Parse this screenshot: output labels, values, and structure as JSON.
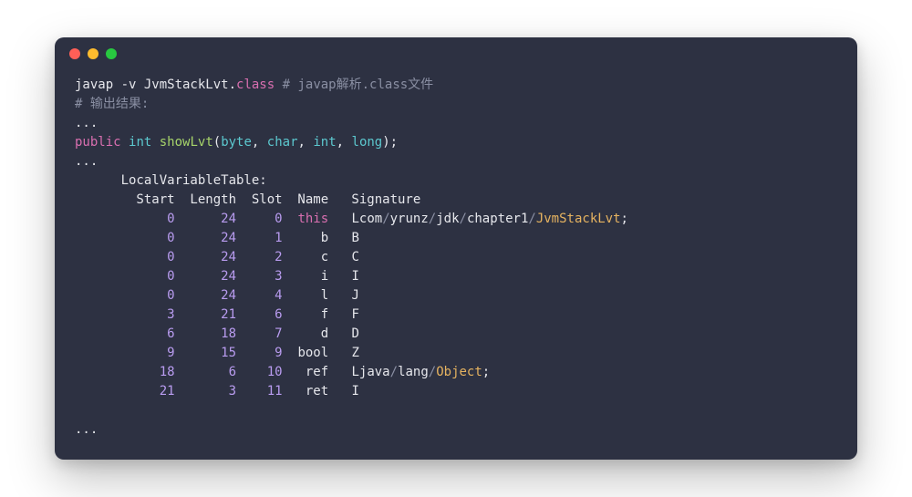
{
  "window": {
    "dot_red": "close",
    "dot_yellow": "minimize",
    "dot_green": "zoom"
  },
  "cmd": {
    "javap": "javap -v JvmStackLvt",
    "dot": ".",
    "class": "class",
    "comment_hash": " # javap解析.class文件"
  },
  "out_comment": "# 输出结果:",
  "ellipsis": "...",
  "sig": {
    "public": "public",
    "int": "int",
    "func": "showLvt",
    "lp": "(",
    "byte": "byte",
    "comma": ", ",
    "char": "char",
    "int2": "int",
    "long": "long",
    "rp": ");"
  },
  "lvt_header": "LocalVariableTable:",
  "columns": {
    "start": "Start",
    "length": "Length",
    "slot": "Slot",
    "name": "Name",
    "signature": "Signature"
  },
  "rows": [
    {
      "start": "0",
      "length": "24",
      "slot": "0",
      "name": "this",
      "sig_pre": "Lcom",
      "sig_segs": [
        "yrunz",
        "jdk",
        "chapter1"
      ],
      "sig_class": "JvmStackLvt",
      "sig_post": ";"
    },
    {
      "start": "0",
      "length": "24",
      "slot": "1",
      "name": "b",
      "sig_plain": "B"
    },
    {
      "start": "0",
      "length": "24",
      "slot": "2",
      "name": "c",
      "sig_plain": "C"
    },
    {
      "start": "0",
      "length": "24",
      "slot": "3",
      "name": "i",
      "sig_plain": "I"
    },
    {
      "start": "0",
      "length": "24",
      "slot": "4",
      "name": "l",
      "sig_plain": "J"
    },
    {
      "start": "3",
      "length": "21",
      "slot": "6",
      "name": "f",
      "sig_plain": "F"
    },
    {
      "start": "6",
      "length": "18",
      "slot": "7",
      "name": "d",
      "sig_plain": "D"
    },
    {
      "start": "9",
      "length": "15",
      "slot": "9",
      "name": "bool",
      "sig_plain": "Z"
    },
    {
      "start": "18",
      "length": "6",
      "slot": "10",
      "name": "ref",
      "sig_pre": "Ljava",
      "sig_segs": [
        "lang"
      ],
      "sig_class": "Object",
      "sig_post": ";"
    },
    {
      "start": "21",
      "length": "3",
      "slot": "11",
      "name": "ret",
      "sig_plain": "I"
    }
  ]
}
